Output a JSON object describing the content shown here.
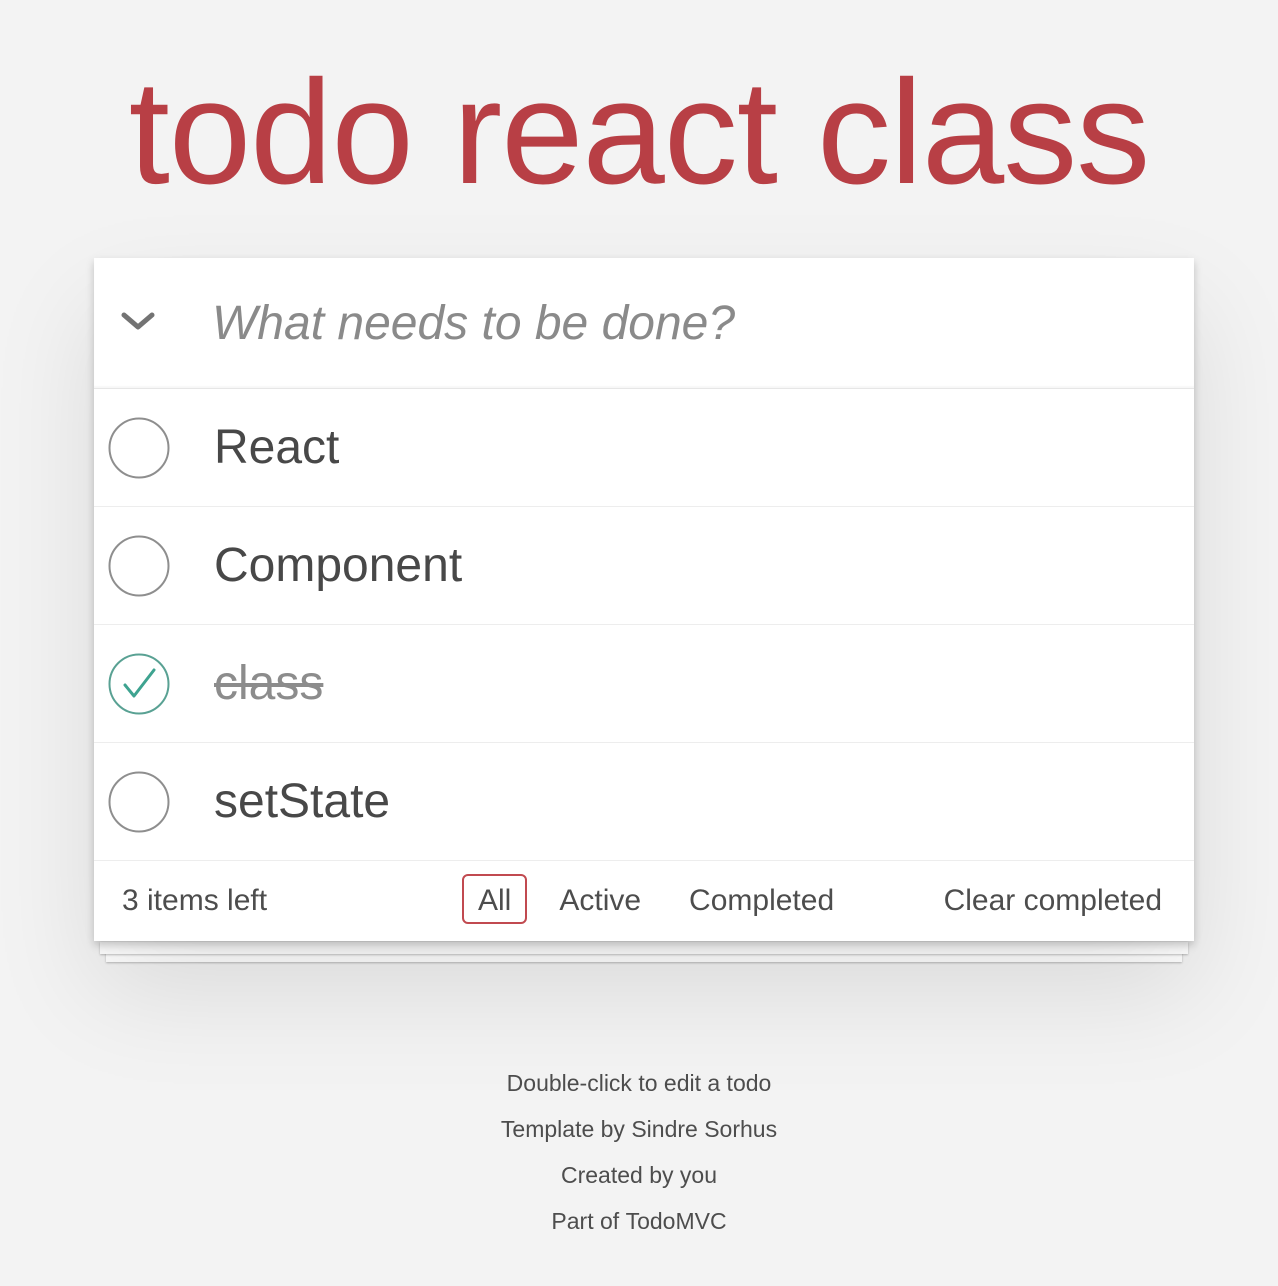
{
  "app": {
    "title": "todo react class"
  },
  "new_todo": {
    "placeholder": "What needs to be done?",
    "value": ""
  },
  "todos": [
    {
      "label": "React",
      "completed": false
    },
    {
      "label": "Component",
      "completed": false
    },
    {
      "label": "class",
      "completed": true
    },
    {
      "label": "setState",
      "completed": false
    }
  ],
  "footer": {
    "count_text": "3 items left",
    "filters": [
      "All",
      "Active",
      "Completed"
    ],
    "selected_filter": "All",
    "clear_completed_label": "Clear completed"
  },
  "info": {
    "edit_hint": "Double-click to edit a todo",
    "template_prefix": "Template by",
    "template_author": "Sindre Sorhus",
    "created_prefix": "Created by",
    "created_author": "you",
    "part_prefix": "Part of",
    "part_link": "TodoMVC"
  },
  "colors": {
    "title": "#b83f45",
    "check": "#5dc2af",
    "selected_filter_border": "#c14a50",
    "background": "#f3f3f3"
  },
  "icons": {
    "toggle_all": "chevron-down-icon",
    "unchecked": "circle-icon",
    "checked": "check-circle-icon"
  }
}
